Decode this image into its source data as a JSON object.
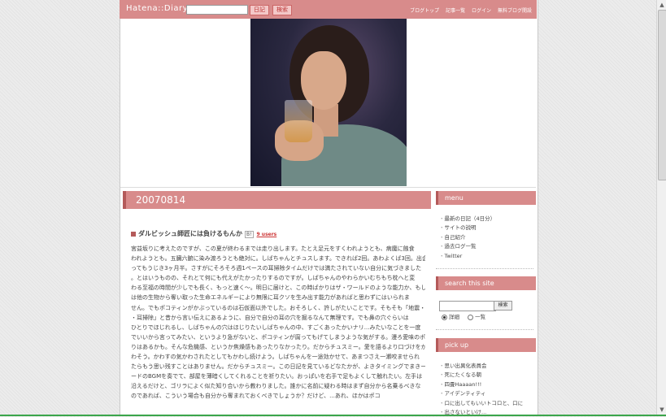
{
  "topbar": {
    "logo": "Hatena::Diary",
    "search_placeholder": "",
    "btn_diary": "日記",
    "btn_search": "検索",
    "links": [
      "ブログトップ",
      "記事一覧",
      "ログイン",
      "無料ブログ開設"
    ]
  },
  "entry": {
    "date": "20070814",
    "title": "ダルビッシュ師匠には負けるもんか",
    "bookmark_label": "B!",
    "users": "9 users",
    "lines": [
      "宮益坂りに考えたのですが、この夏が終わるまでは走り出します。たとえ足元をすくわれようとも、病魔に蝕食",
      "われようとも。五臓六腑に染み渡ろうとも絶対に。しばちゃんとチュスします。できれば2回。あわよくば3回。出会",
      "ってもうじき3ヶ月半。さすがにそろそろ週1ペースの耳掃除タイムだけでは満たされていない自分に気づきました",
      "。とはいうものの、それとて何にも代えがたかったりするのですが。しばちゃんのやわらかいむちもち枕へと変",
      "わる至福の時間が少しでも長く、もっと速く〜。明日に届けと、この時ばかりはザ・ワールドのような能力か、もしく",
      "は他の生物から奪い取った生命エネルギーにより無限に耳クソを生み出す能力があればと思わずにはいられま",
      "せん。でもポコティンがかぶっているのは石仮面以外でした。おそろしく、許しがたいことです。そもそも「地震・雷",
      "・耳掃除」と昔から言い伝えにあるように、自分で自分の耳の穴を掘るなんて無理です。でも鼻の穴ぐらいは",
      "ひとりでほじれるし、しばちゃんの穴はほじりたいしばちゃんの中、すごくあったかいナリ...みたいなことを一度",
      "でいいから言ってみたい、というより急がないと、ポコティンが腐ってもげてしまうような気がする。漫ろ愛味のポロ",
      "りはあるかも。そんな危機感、というか焦燥感もあったりなかったり。だからチュスミー。愛を語るより口づけをか",
      "わそう。かわすの気かわされたとしてもかわし続けよう。しばちゃんを一途効かせて、あまつさえ一瀬咬ませられ",
      "たらもう思い残すことはありません。だからチュスミー。この日記を見ているどなたかが、よきタイミングでまきー",
      "ードのBGMを奏でて、部屋を薄暗くしてくれることを祈りたい。おっぱいを右手で足もよくして触れたい。左手は",
      "沿えるだけと、ゴリラによく似た知り合いから教わりました。誰かに名前に疑わる時はまず自分から名乗るべきな",
      "のであれば、こういう場合も自分から奪まれておくべきでしょうか？だけど、...あれ、ほかはポコ"
    ]
  },
  "sidebar": {
    "menu_title": "menu",
    "menu_items": [
      "最新の日記（4日分）",
      "サイトの説明",
      "自己紹介",
      "過去ログ一覧",
      "Twitter"
    ],
    "search_title": "search this site",
    "search_btn": "検索",
    "radio_detail": "詳細",
    "radio_list": "一覧",
    "pickup_title": "pick up",
    "pickup_items": [
      "思い出異化表員会",
      "死にたくなる朝",
      "四畳Haaaan!!!",
      "アイデンティティ",
      "口に出してもいいトコロと、口に",
      "出さないといけ..."
    ]
  },
  "colors": {
    "accent": "#d88b8b",
    "accent_dark": "#b45a5a",
    "link_red": "#cc3333"
  }
}
